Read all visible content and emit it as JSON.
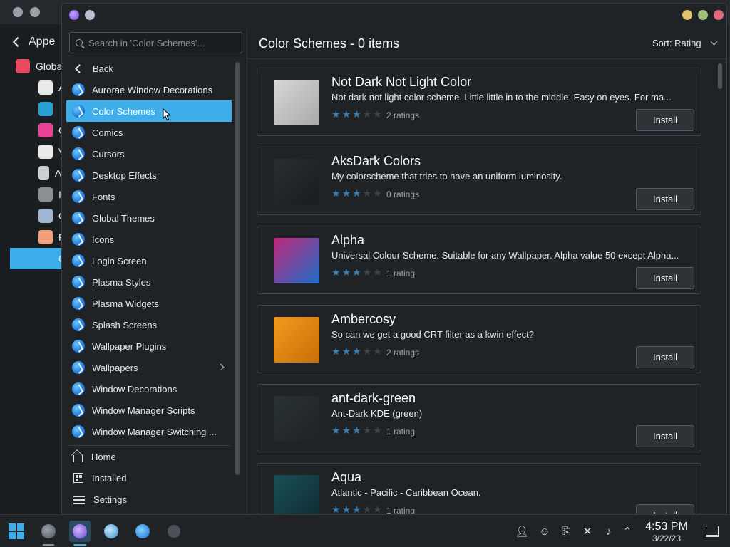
{
  "background_window": {
    "back_label": "Appe",
    "rows": [
      {
        "label": "Globa",
        "color": "#e84a5f"
      },
      {
        "label": "A",
        "color": "#eaeaea"
      },
      {
        "label": "",
        "color": "#2a9fd6"
      },
      {
        "label": "C",
        "color": "#e84393"
      },
      {
        "label": "V",
        "color": "#eaeaea"
      },
      {
        "label": "Aa",
        "color": "#cfcfcf"
      },
      {
        "label": "I",
        "color": "#8e8e8e"
      },
      {
        "label": "C",
        "color": "#9fb6d0"
      },
      {
        "label": "F",
        "color": "#f2a07b"
      },
      {
        "label": "C",
        "color": "#3daee9"
      }
    ]
  },
  "window": {
    "search_placeholder": "Search in 'Color Schemes'...",
    "back_label": "Back",
    "categories": [
      {
        "label": "Aurorae Window Decorations"
      },
      {
        "label": "Color Schemes",
        "selected": true
      },
      {
        "label": "Comics"
      },
      {
        "label": "Cursors"
      },
      {
        "label": "Desktop Effects"
      },
      {
        "label": "Fonts"
      },
      {
        "label": "Global Themes"
      },
      {
        "label": "Icons"
      },
      {
        "label": "Login Screen"
      },
      {
        "label": "Plasma Styles"
      },
      {
        "label": "Plasma Widgets"
      },
      {
        "label": "Splash Screens"
      },
      {
        "label": "Wallpaper Plugins"
      },
      {
        "label": "Wallpapers",
        "has_submenu": true
      },
      {
        "label": "Window Decorations"
      },
      {
        "label": "Window Manager Scripts"
      },
      {
        "label": "Window Manager Switching ..."
      }
    ],
    "nav": {
      "home": "Home",
      "installed": "Installed",
      "settings": "Settings"
    },
    "page_title": "Color Schemes - 0 items",
    "sort_label": "Sort: Rating",
    "items": [
      {
        "name": "Not Dark Not Light Color",
        "description": "Not dark not light color scheme. Little little in to the middle. Easy on eyes. For ma...",
        "stars": 3,
        "ratings": "2 ratings",
        "install": "Install",
        "thumb_colors": [
          "#d7d7d7",
          "#a9a9a9"
        ]
      },
      {
        "name": "AksDark Colors",
        "description": "My colorscheme that tries to have an uniform luminosity.",
        "stars": 3,
        "ratings": "0 ratings",
        "install": "Install",
        "thumb_colors": [
          "#2a2d31",
          "#1a1c1f"
        ]
      },
      {
        "name": "Alpha",
        "description": "Universal Colour Scheme. Suitable for any Wallpaper. Alpha value 50 except Alpha...",
        "stars": 3,
        "ratings": "1 rating",
        "install": "Install",
        "thumb_colors": [
          "#c0287a",
          "#1f6fc9"
        ]
      },
      {
        "name": "Ambercosy",
        "description": "So can we get a good CRT filter as a kwin effect?",
        "stars": 3,
        "ratings": "2 ratings",
        "install": "Install",
        "thumb_colors": [
          "#f29a1d",
          "#c66f08"
        ]
      },
      {
        "name": "ant-dark-green",
        "description": "Ant-Dark KDE (green)",
        "stars": 3,
        "ratings": "1 rating",
        "install": "Install",
        "thumb_colors": [
          "#2b3236",
          "#1c2326"
        ]
      },
      {
        "name": "Aqua",
        "description": "Atlantic - Pacific - Caribbean Ocean.",
        "stars": 3,
        "ratings": "1 rating",
        "install": "Install",
        "thumb_colors": [
          "#1c4f58",
          "#0d2b33"
        ]
      }
    ]
  },
  "taskbar": {
    "time": "4:53 PM",
    "date": "3/22/23",
    "accent": "#3daee9"
  }
}
